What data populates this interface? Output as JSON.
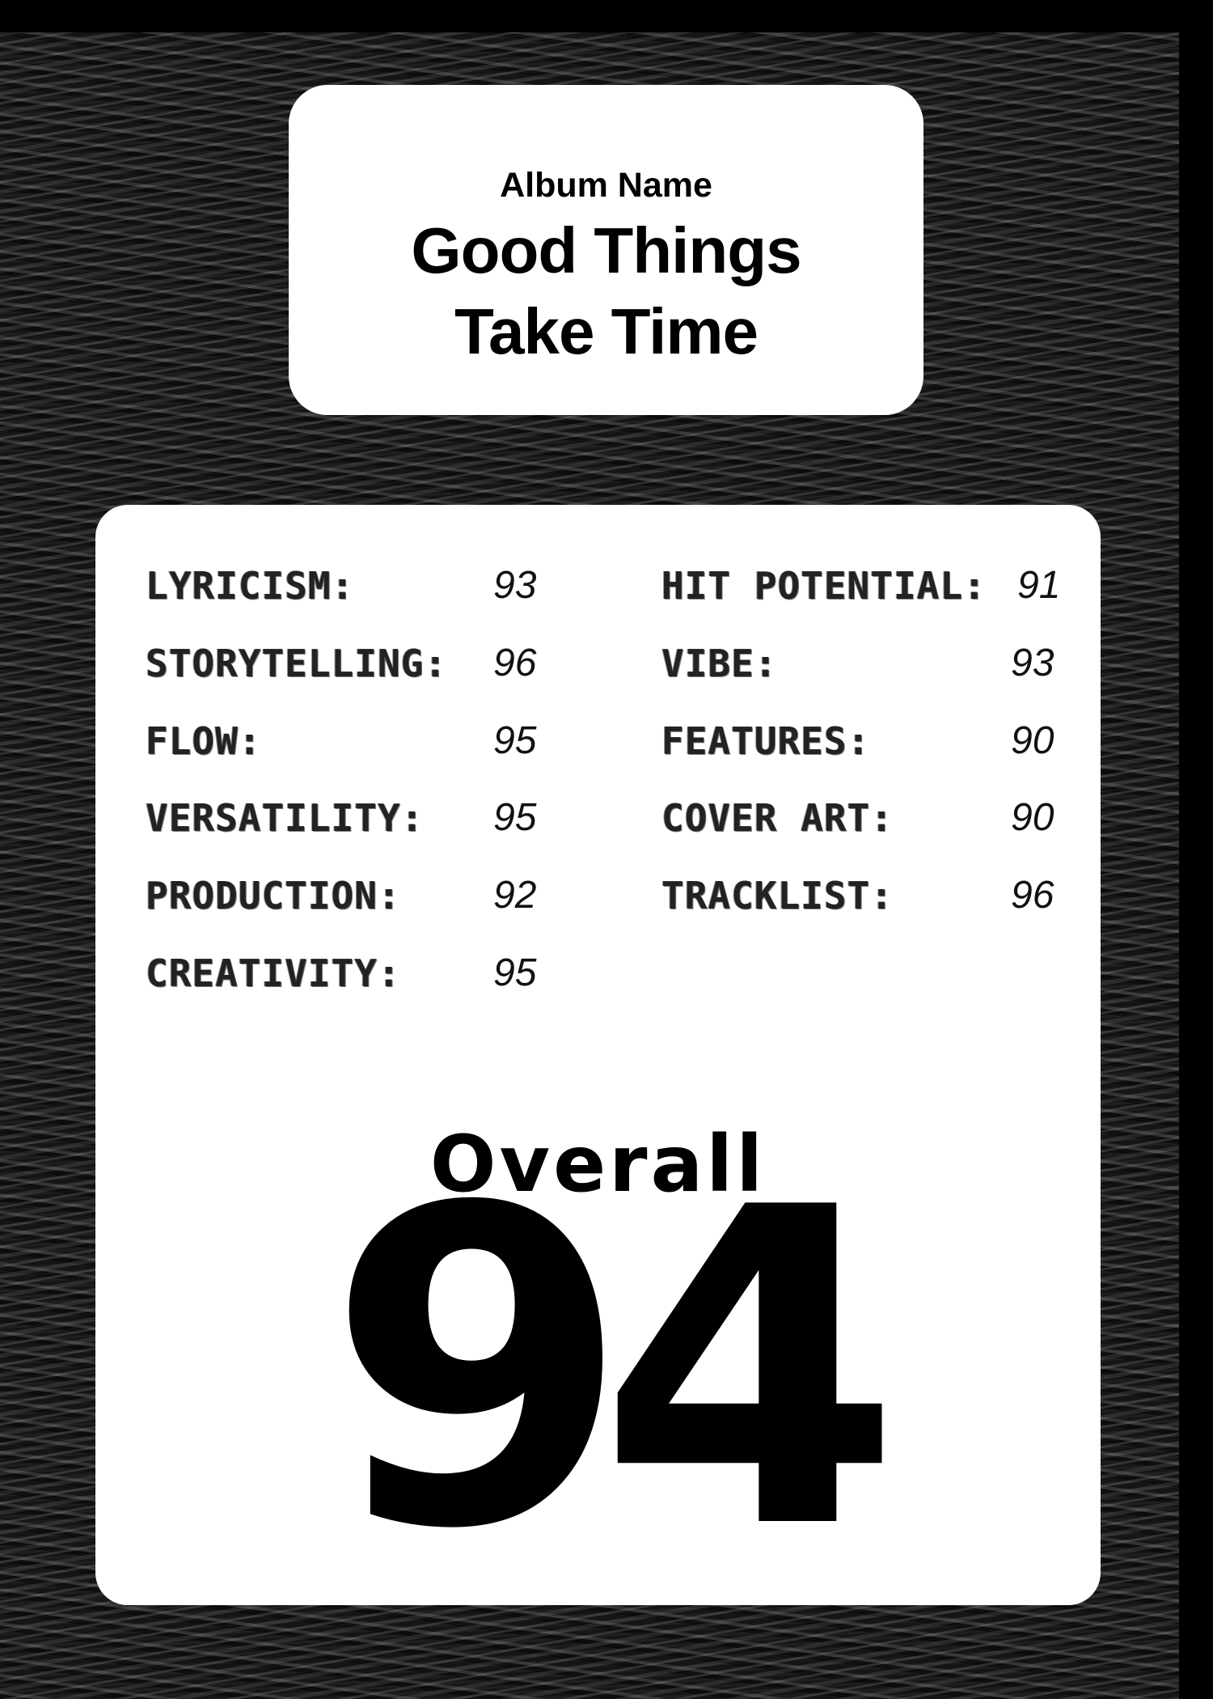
{
  "album": {
    "label": "Album Name",
    "title_line1": "Good Things",
    "title_line2": "Take Time"
  },
  "ratings_left": [
    {
      "label": "LYRICISM:",
      "value": "93"
    },
    {
      "label": "STORYTELLING:",
      "value": "96"
    },
    {
      "label": "FLOW:",
      "value": "95"
    },
    {
      "label": "VERSATILITY:",
      "value": "95"
    },
    {
      "label": "PRODUCTION:",
      "value": "92"
    },
    {
      "label": "CREATIVITY:",
      "value": "95"
    }
  ],
  "ratings_right": [
    {
      "label": "HIT POTENTIAL:",
      "value": "91"
    },
    {
      "label": "VIBE:",
      "value": "93"
    },
    {
      "label": "FEATURES:",
      "value": "90"
    },
    {
      "label": "COVER ART:",
      "value": "90"
    },
    {
      "label": "TRACKLIST:",
      "value": "96"
    }
  ],
  "overall": {
    "label": "Overall",
    "value": "94"
  }
}
